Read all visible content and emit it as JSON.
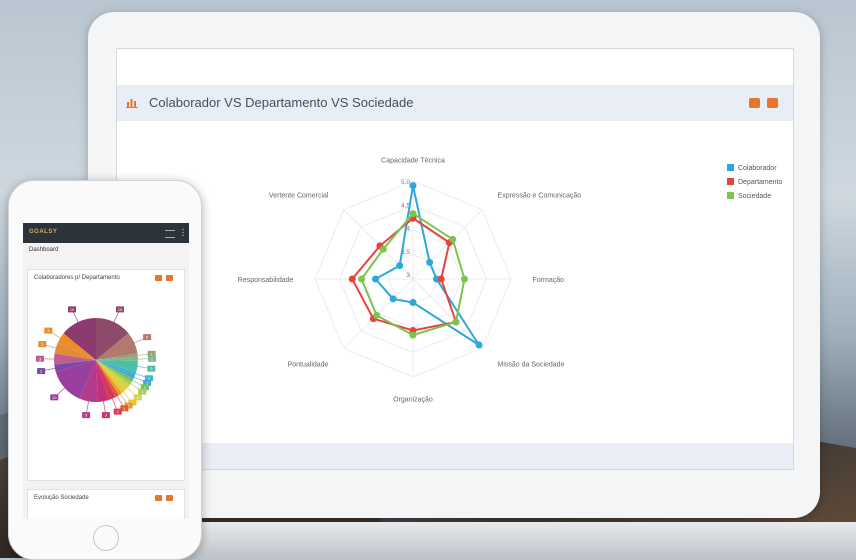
{
  "laptop": {
    "title": "Colaborador VS Departamento VS Sociedade",
    "chart_data": {
      "type": "radar",
      "axes": [
        "Capacidade Técnica",
        "Expressão e Comunicação",
        "Formação",
        "Missão da Sociedade",
        "Organização",
        "Pontualidade",
        "Responsabilidade",
        "Vertente Comercial"
      ],
      "ticks": [
        "3",
        "3.5",
        "4",
        "4.5",
        "5.0"
      ],
      "range": [
        3,
        5
      ],
      "series": [
        {
          "name": "Colaborador",
          "color": "#2ba8dc",
          "values": [
            4.9,
            3.4,
            3.4,
            4.9,
            3.4,
            3.5,
            3.7,
            3.3
          ]
        },
        {
          "name": "Departamento",
          "color": "#e8423f",
          "values": [
            4.2,
            4.0,
            3.5,
            4.2,
            4.0,
            4.1,
            4.2,
            3.9
          ]
        },
        {
          "name": "Sociedade",
          "color": "#7cc44e",
          "values": [
            4.3,
            4.1,
            4.0,
            4.2,
            4.1,
            4.0,
            4.0,
            3.8
          ]
        }
      ],
      "legend_position": "top-right"
    }
  },
  "phone": {
    "logo": "GOALSY",
    "dashboard_label": "Dashboard",
    "card1_title": "Colaboradores p/ Departamento",
    "card2_title": "Evolução Sociedade",
    "pie_labels": [
      "10",
      "6",
      "1",
      "1",
      "3",
      "1",
      "1",
      "1",
      "1",
      "2",
      "1",
      "1",
      "1",
      "2",
      "3",
      "5",
      "10",
      "2",
      "3",
      "3",
      "3",
      "10"
    ],
    "icons": [
      "chart-icon",
      "print-icon",
      "expand-icon",
      "menu-icon",
      "more-icon"
    ]
  }
}
